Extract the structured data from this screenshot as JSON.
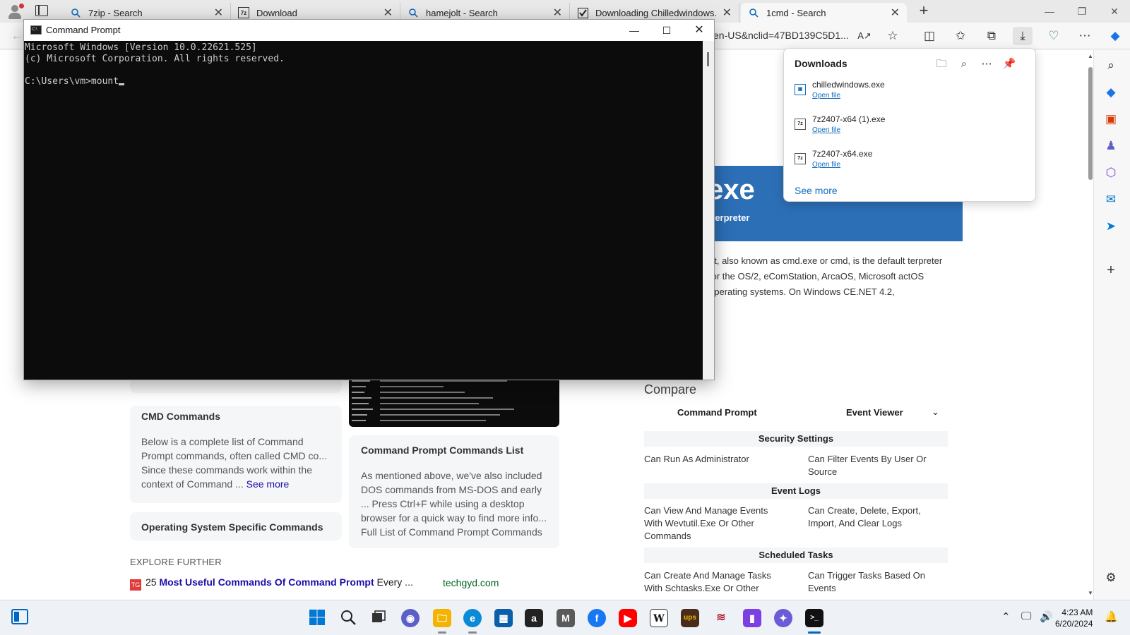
{
  "browser": {
    "tabs": [
      {
        "label": "7zip - Search",
        "icon": "search-icon"
      },
      {
        "label": "Download",
        "icon": "7zip-logo-icon"
      },
      {
        "label": "hamejolt - Search",
        "icon": "search-icon"
      },
      {
        "label": "Downloading Chilledwindows.ex",
        "icon": "site-logo-icon"
      },
      {
        "label": "1cmd - Search",
        "icon": "search-icon",
        "active": true
      }
    ],
    "url": "en-US&nclid=47BD139C5D1..."
  },
  "downloads": {
    "title": "Downloads",
    "items": [
      {
        "name": "chilledwindows.exe",
        "action": "Open file"
      },
      {
        "name": "7z2407-x64 (1).exe",
        "action": "Open file"
      },
      {
        "name": "7z2407-x64.exe",
        "action": "Open file"
      }
    ],
    "see_more": "See more"
  },
  "cmd": {
    "title": "Command Prompt",
    "lines": [
      "Microsoft Windows [Version 10.0.22621.525]",
      "(c) Microsoft Corporation. All rights reserved.",
      "",
      "C:\\Users\\vm>mount"
    ]
  },
  "page": {
    "hero_big": "exe",
    "hero_sub": "terpreter",
    "description": "pt, also known as cmd.exe or cmd, is the default terpreter for the OS/2, eComStation, ArcaOS, Microsoft actOS operating systems. On Windows CE.NET 4.2,",
    "cards": [
      {
        "title": "CMD Commands",
        "body": "Below is a complete list of Command Prompt commands, often called CMD co... Since these commands work within the context of Command ...",
        "more": "See more"
      },
      {
        "title": "Command Prompt Commands List",
        "body": "As mentioned above, we've also included DOS commands from MS-DOS and early ... Press Ctrl+F while using a desktop browser for a quick way to find more info... Full List of Command Prompt Commands",
        "more": ""
      },
      {
        "title": "Operating System Specific Commands",
        "body": "",
        "more": ""
      }
    ],
    "explore_heading": "EXPLORE FURTHER",
    "explore_item": {
      "prefix": "25 ",
      "bold": "Most Useful Commands Of Command Prompt",
      "suffix": " Every ...",
      "source": "techgyd.com"
    },
    "compare": {
      "title": "Compare",
      "left": "Command Prompt",
      "right": "Event Viewer",
      "sections": [
        {
          "heading": "Security Settings",
          "left": "Can Run As Administrator",
          "right": "Can Filter Events By User Or Source"
        },
        {
          "heading": "Event Logs",
          "left": "Can View And Manage Events With Wevtutil.Exe Or Other Commands",
          "right": "Can Create, Delete, Export, Import, And Clear Logs"
        },
        {
          "heading": "Scheduled Tasks",
          "left": "Can Create And Manage Tasks With Schtasks.Exe Or Other",
          "right": "Can Trigger Tasks Based On Events"
        }
      ]
    }
  },
  "taskbar": {
    "time": "4:23 AM",
    "date": "6/20/2024"
  },
  "colors": {
    "accent": "#0067c0",
    "console_bg": "#0c0c0c",
    "console_fg": "#cccccc",
    "hero": "#2c6fb6"
  }
}
